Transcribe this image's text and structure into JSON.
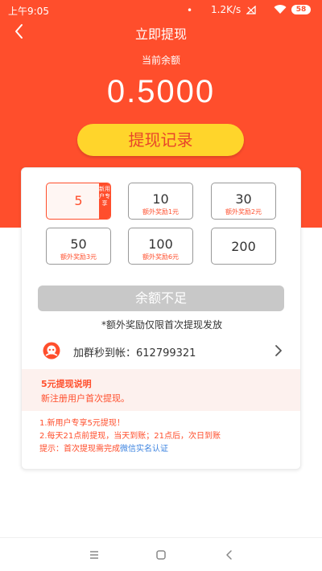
{
  "status": {
    "time": "上午9:05",
    "dot": "•",
    "speed": "1.2K/s",
    "battery": "58",
    "icons": [
      "muted-signal-icon",
      "wifi-icon",
      "battery-icon"
    ]
  },
  "header": {
    "title": "立即提现",
    "back_icon": "back-chevron-icon"
  },
  "balance": {
    "label": "当前余额",
    "value": "0.5000"
  },
  "record_button": "提现记录",
  "amounts": [
    {
      "amount": "5",
      "tag": "新用户专享",
      "selected": true
    },
    {
      "amount": "10",
      "bonus": "额外奖励1元"
    },
    {
      "amount": "30",
      "bonus": "额外奖励2元"
    },
    {
      "amount": "50",
      "bonus": "额外奖励3元"
    },
    {
      "amount": "100",
      "bonus": "额外奖励6元"
    },
    {
      "amount": "200"
    }
  ],
  "insufficient_button": "余额不足",
  "bonus_note": "*额外奖励仅限首次提现发放",
  "group": {
    "label": "加群秒到帐：612799321",
    "icon": "group-avatar-icon"
  },
  "explain": {
    "title": "5元提现说明",
    "desc": "新注册用户首次提现。"
  },
  "rules": {
    "line1": "1.新用户专享5元提现！",
    "line2": "2.每天21点前提现，当天到账；21点后，次日到账",
    "line3_prefix": "提示：首次提现需完成",
    "line3_link": "微信实名认证"
  },
  "colors": {
    "primary": "#ff4e2c",
    "button_yellow": "#ffd52b",
    "link": "#3d84e0"
  }
}
